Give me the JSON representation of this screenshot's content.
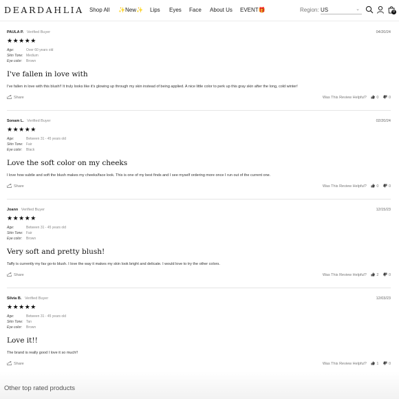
{
  "header": {
    "logo": "DEARDAHLIA",
    "nav": [
      {
        "label": "Shop All"
      },
      {
        "label": "✨New✨"
      },
      {
        "label": "Lips"
      },
      {
        "label": "Eyes"
      },
      {
        "label": "Face"
      },
      {
        "label": "About Us"
      },
      {
        "label": "EVENT🎁"
      }
    ],
    "region_label": "Region:",
    "region_value": "US",
    "cart_count": "0",
    "icons": [
      "search-icon",
      "account-icon",
      "cart-icon"
    ]
  },
  "reviews": [
    {
      "name": "PAULA P.",
      "verified": "Verified Buyer",
      "date": "04/20/24",
      "stars": "★★★★★",
      "rating": 5,
      "age_label": "Age:",
      "age": "Over 60 years old",
      "skin_label": "Skin Tone:",
      "skin": "Medium",
      "eye_label": "Eye color:",
      "eye": "Brown",
      "title": "I've fallen in love with",
      "body": "I've fallen in love with this blush!! It truly looks like it's glowing up through my skin instead of being applied. A nice little color to perk up this gray skin after the long, cold winter!",
      "share": "Share",
      "helpful_label": "Was This Review Helpful?",
      "up": "0",
      "down": "0"
    },
    {
      "name": "Sonam L.",
      "verified": "Verified Buyer",
      "date": "02/20/24",
      "stars": "★★★★★",
      "rating": 5,
      "age_label": "Age:",
      "age": "Between 31 - 45 years old",
      "skin_label": "Skin Tone:",
      "skin": "Fair",
      "eye_label": "Eye color:",
      "eye": "Black",
      "title": "Love the soft color on my cheeks",
      "body": "I love how subtle and soft the blush makes my cheeks/face look. This is one of my best finds and I see myself ordering more once I run out of the current one.",
      "share": "Share",
      "helpful_label": "Was This Review Helpful?",
      "up": "0",
      "down": "0"
    },
    {
      "name": "Joann",
      "verified": "Verified Buyer",
      "date": "12/15/23",
      "stars": "★★★★★",
      "rating": 5,
      "age_label": "Age:",
      "age": "Between 31 - 45 years old",
      "skin_label": "Skin Tone:",
      "skin": "Fair",
      "eye_label": "Eye color:",
      "eye": "Brown",
      "title": "Very soft and pretty blush!",
      "body": "Taffy is currently my fav go-to blush. I love the way it makes my skin look bright and delicate. I would love to try the other colors.",
      "share": "Share",
      "helpful_label": "Was This Review Helpful?",
      "up": "2",
      "down": "0"
    },
    {
      "name": "Silvia B.",
      "verified": "Verified Buyer",
      "date": "12/03/23",
      "stars": "★★★★★",
      "rating": 5,
      "age_label": "Age:",
      "age": "Between 31 - 45 years old",
      "skin_label": "Skin Tone:",
      "skin": "Tan",
      "eye_label": "Eye color:",
      "eye": "Brown",
      "title": "Love it!!",
      "body": "The brand is really good I love it so much!!",
      "share": "Share",
      "helpful_label": "Was This Review Helpful?",
      "up": "1",
      "down": "0"
    }
  ],
  "other_products_title": "Other top rated products"
}
